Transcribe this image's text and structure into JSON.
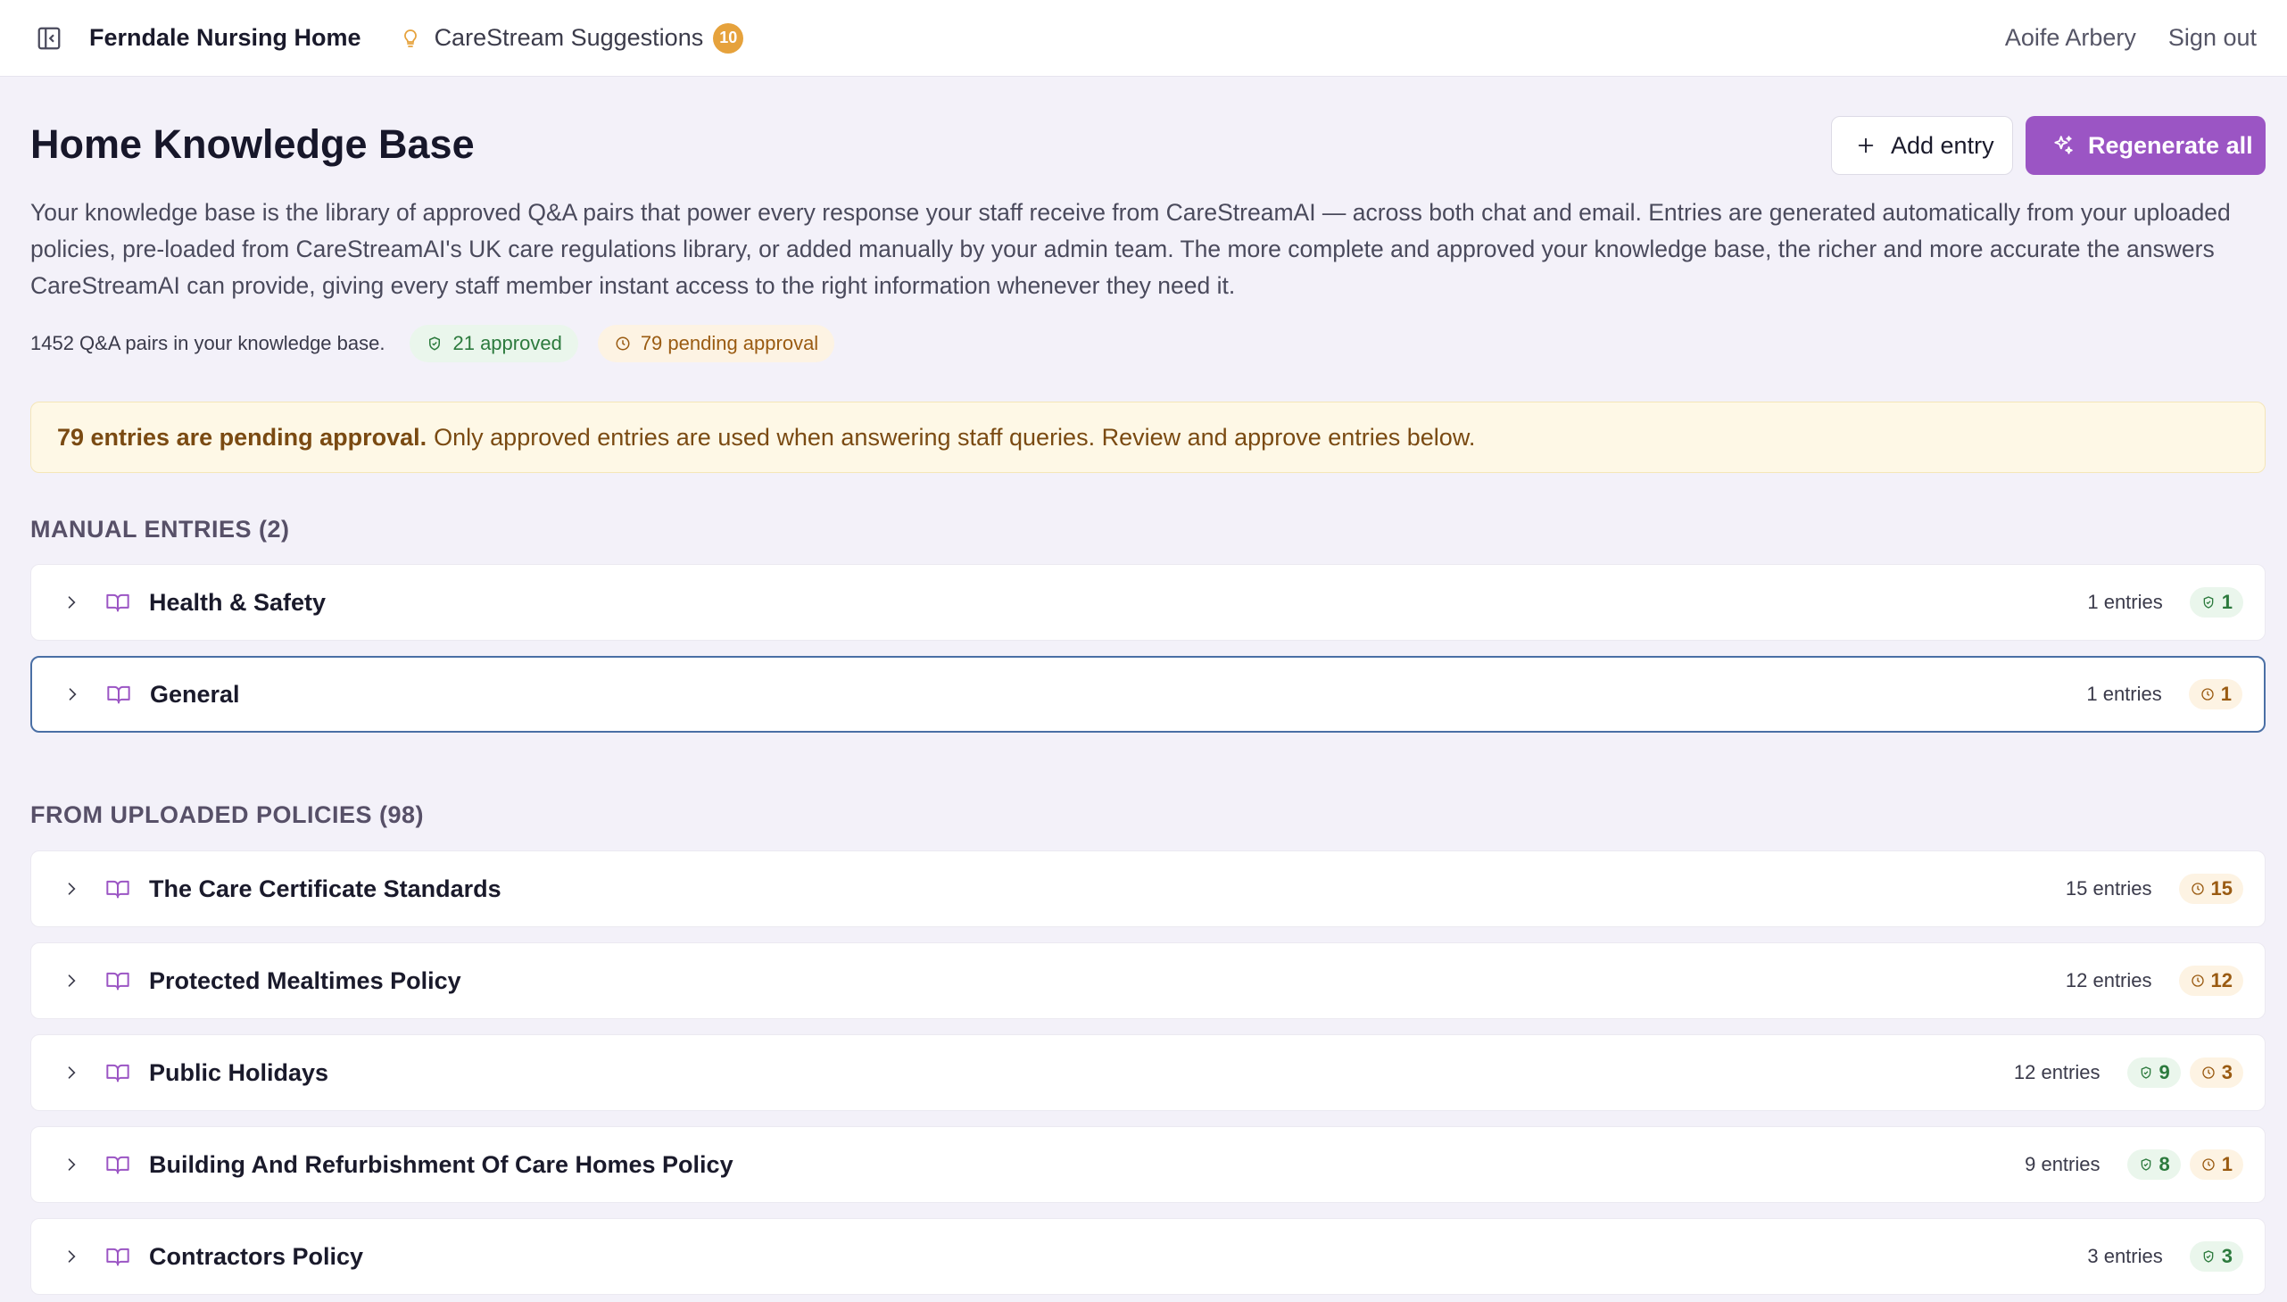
{
  "topbar": {
    "brand": "Ferndale Nursing Home",
    "suggestions_label": "CareStream Suggestions",
    "suggestions_count": "10",
    "user_name": "Aoife Arbery",
    "sign_out": "Sign out"
  },
  "header": {
    "title": "Home Knowledge Base",
    "add_entry_label": "Add entry",
    "regenerate_label": "Regenerate all",
    "description": "Your knowledge base is the library of approved Q&A pairs that power every response your staff receive from CareStreamAI — across both chat and email. Entries are generated automatically from your uploaded policies, pre-loaded from CareStreamAI's UK care regulations library, or added manually by your admin team. The more complete and approved your knowledge base, the richer and more accurate the answers CareStreamAI can provide, giving every staff member instant access to the right information whenever they need it."
  },
  "stats": {
    "total": "1452 Q&A pairs in your knowledge base.",
    "approved": "21 approved",
    "pending": "79 pending approval"
  },
  "alert": {
    "bold": "79 entries are pending approval.",
    "text": "Only approved entries are used when answering staff queries. Review and approve entries below."
  },
  "manual": {
    "title": "MANUAL ENTRIES (2)",
    "items": [
      {
        "name": "Health & Safety",
        "entries": "1 entries",
        "approved": "1",
        "pending": null
      },
      {
        "name": "General",
        "entries": "1 entries",
        "approved": null,
        "pending": "1"
      }
    ]
  },
  "uploaded": {
    "title": "FROM UPLOADED POLICIES (98)",
    "items": [
      {
        "name": "The Care Certificate Standards",
        "entries": "15 entries",
        "approved": null,
        "pending": "15"
      },
      {
        "name": "Protected Mealtimes Policy",
        "entries": "12 entries",
        "approved": null,
        "pending": "12"
      },
      {
        "name": "Public Holidays",
        "entries": "12 entries",
        "approved": "9",
        "pending": "3"
      },
      {
        "name": "Building And Refurbishment Of Care Homes Policy",
        "entries": "9 entries",
        "approved": "8",
        "pending": "1"
      },
      {
        "name": "Contractors Policy",
        "entries": "3 entries",
        "approved": "3",
        "pending": null
      }
    ]
  },
  "colors": {
    "accent": "#9b55c4",
    "approved": "#2c7a3d",
    "pending": "#9a5b12",
    "badge_orange": "#e6a23c"
  }
}
